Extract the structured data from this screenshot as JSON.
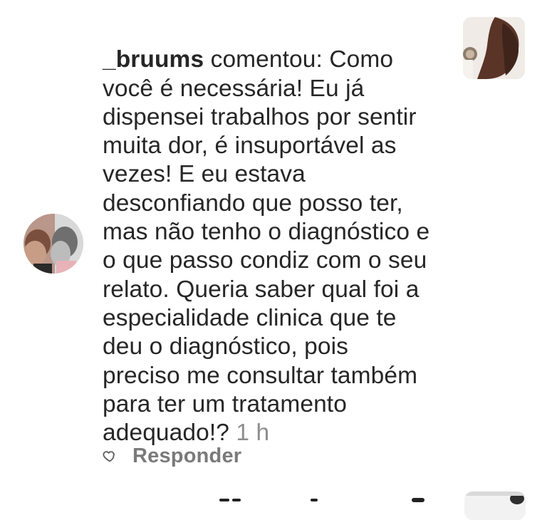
{
  "comment": {
    "username": "_bruums",
    "action_text": " comentou: ",
    "text": "Como\nvocê é necessária! Eu já\ndispensei trabalhos por sentir\nmuita dor, é insuportável as\nvezes! E eu estava\ndesconfiando que posso ter,\nmas não tenho o diagnóstico e\no que passo condiz com o seu\nrelato. Queria saber qual foi a\nespecialidade clinica que te\ndeu o diagnóstico, pois\npreciso me consultar também\npara ter um tratamento\nadequado!?",
    "time": " 1 h",
    "reply_label": "Responder"
  },
  "icons": {
    "like": "heart-outline-icon"
  },
  "colors": {
    "text": "#262626",
    "muted": "#8e8e8e",
    "background": "#ffffff"
  }
}
